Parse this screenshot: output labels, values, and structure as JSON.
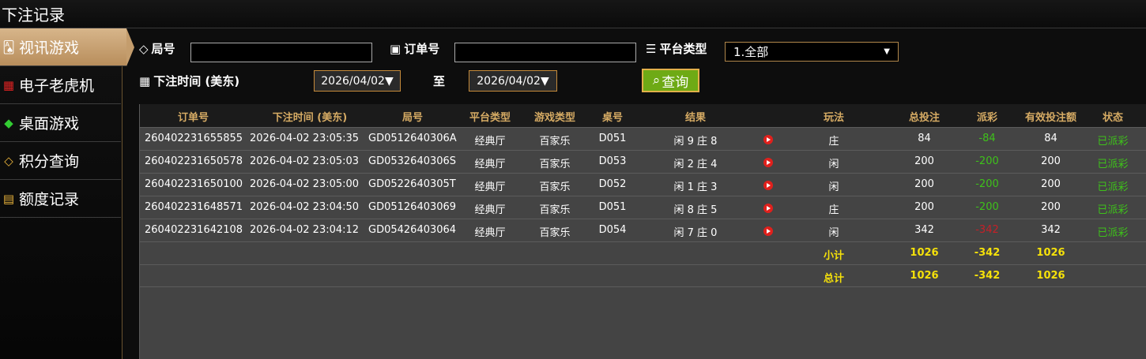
{
  "window": {
    "title": "下注记录"
  },
  "sidebar": {
    "items": [
      {
        "label": "视讯游戏",
        "icon": "cards-icon",
        "active": true
      },
      {
        "label": "电子老虎机",
        "icon": "slot-machine-icon",
        "active": false
      },
      {
        "label": "桌面游戏",
        "icon": "chip-icon",
        "active": false
      },
      {
        "label": "积分查询",
        "icon": "diamond-icon",
        "active": false
      },
      {
        "label": "额度记录",
        "icon": "document-icon",
        "active": false
      }
    ]
  },
  "filters": {
    "round_label": "局号",
    "round_value": "",
    "order_label": "订单号",
    "order_value": "",
    "platform_label": "平台类型",
    "platform_selected": "1.全部",
    "time_label": "下注时间 (美东)",
    "date_from": "2026/04/02▼",
    "to_label": "至",
    "date_to": "2026/04/02▼",
    "query_button": "查询"
  },
  "table": {
    "headers": [
      "订单号",
      "下注时间 (美东)",
      "局号",
      "平台类型",
      "游戏类型",
      "桌号",
      "结果",
      "玩法",
      "总投注",
      "派彩",
      "有效投注额",
      "状态"
    ],
    "rows": [
      {
        "order": "260402231655855",
        "time": "2026-04-02 23:05:35",
        "round": "GD0512640306A",
        "platform": "经典厅",
        "game": "百家乐",
        "table": "D051",
        "result": "闲 9 庄 8",
        "bet_type": "庄",
        "total_bet": "84",
        "payout": "-84",
        "payout_color": "green",
        "valid_bet": "84",
        "status": "已派彩"
      },
      {
        "order": "260402231650578",
        "time": "2026-04-02 23:05:03",
        "round": "GD0532640306S",
        "platform": "经典厅",
        "game": "百家乐",
        "table": "D053",
        "result": "闲 2 庄 4",
        "bet_type": "闲",
        "total_bet": "200",
        "payout": "-200",
        "payout_color": "green",
        "valid_bet": "200",
        "status": "已派彩"
      },
      {
        "order": "260402231650100",
        "time": "2026-04-02 23:05:00",
        "round": "GD0522640305T",
        "platform": "经典厅",
        "game": "百家乐",
        "table": "D052",
        "result": "闲 1 庄 3",
        "bet_type": "闲",
        "total_bet": "200",
        "payout": "-200",
        "payout_color": "green",
        "valid_bet": "200",
        "status": "已派彩"
      },
      {
        "order": "260402231648571",
        "time": "2026-04-02 23:04:50",
        "round": "GD05126403069",
        "platform": "经典厅",
        "game": "百家乐",
        "table": "D051",
        "result": "闲 8 庄 5",
        "bet_type": "庄",
        "total_bet": "200",
        "payout": "-200",
        "payout_color": "green",
        "valid_bet": "200",
        "status": "已派彩"
      },
      {
        "order": "260402231642108",
        "time": "2026-04-02 23:04:12",
        "round": "GD05426403064",
        "platform": "经典厅",
        "game": "百家乐",
        "table": "D054",
        "result": "闲 7 庄 0",
        "bet_type": "闲",
        "total_bet": "342",
        "payout": "-342",
        "payout_color": "red",
        "valid_bet": "342",
        "status": "已派彩"
      }
    ],
    "subtotal": {
      "label": "小计",
      "total_bet": "1026",
      "payout": "-342",
      "valid_bet": "1026"
    },
    "total": {
      "label": "总计",
      "total_bet": "1026",
      "payout": "-342",
      "valid_bet": "1026"
    }
  },
  "colors": {
    "accent_gold": "#d6ab64",
    "status_green": "#3ec11a",
    "loss_red": "#c52027",
    "sum_yellow": "#f5e10a",
    "query_green": "#6eaa15"
  }
}
